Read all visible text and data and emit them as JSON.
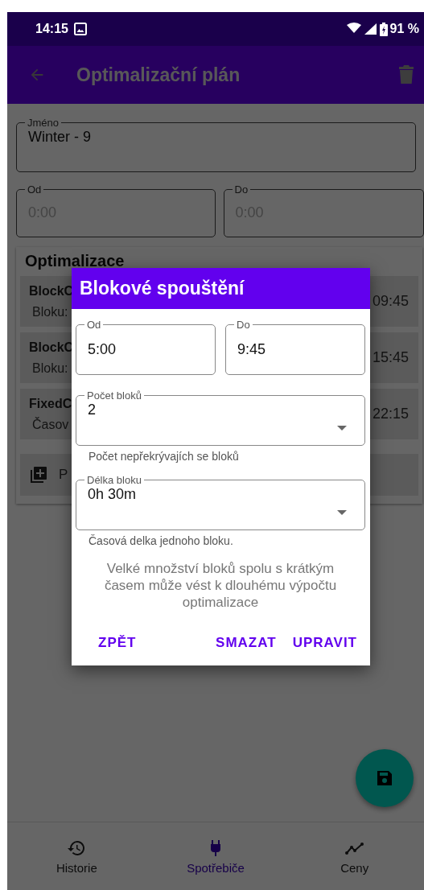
{
  "status_bar": {
    "time": "14:15",
    "battery": "91 %"
  },
  "app_bar": {
    "title": "Optimalizační plán"
  },
  "form": {
    "name_field": {
      "label": "Jméno",
      "value": "Winter - 9"
    },
    "from_field": {
      "label": "Od",
      "placeholder": "0:00"
    },
    "to_field": {
      "label": "Do",
      "placeholder": "0:00"
    }
  },
  "optimization": {
    "title": "Optimalizace",
    "items": [
      {
        "name": "BlockC",
        "detail": "Bloku:",
        "time": "09:45"
      },
      {
        "name": "BlockC",
        "detail": "Bloku:",
        "time": "15:45"
      },
      {
        "name": "FixedC",
        "detail": "Časov",
        "time": "22:15"
      }
    ],
    "add_label": "P"
  },
  "dialog": {
    "title": "Blokové spouštění",
    "from_field": {
      "label": "Od",
      "value": "5:00"
    },
    "to_field": {
      "label": "Do",
      "value": "9:45"
    },
    "count_field": {
      "label": "Počet bloků",
      "value": "2",
      "helper": "Počet nepřekrývajích se bloků"
    },
    "length_field": {
      "label": "Délka bloku",
      "value": "0h 30m",
      "helper": "Časová delka jednoho bloku."
    },
    "warning": "Velké množství  bloků spolu s krátkým časem může vést k dlouhému výpočtu optimalizace",
    "buttons": [
      "ZPĚT",
      "SMAZAT",
      "UPRAVIT"
    ]
  },
  "bottom_nav": [
    {
      "label": "Historie",
      "selected": false
    },
    {
      "label": "Spotřebiče",
      "selected": true
    },
    {
      "label": "Ceny",
      "selected": false
    }
  ]
}
